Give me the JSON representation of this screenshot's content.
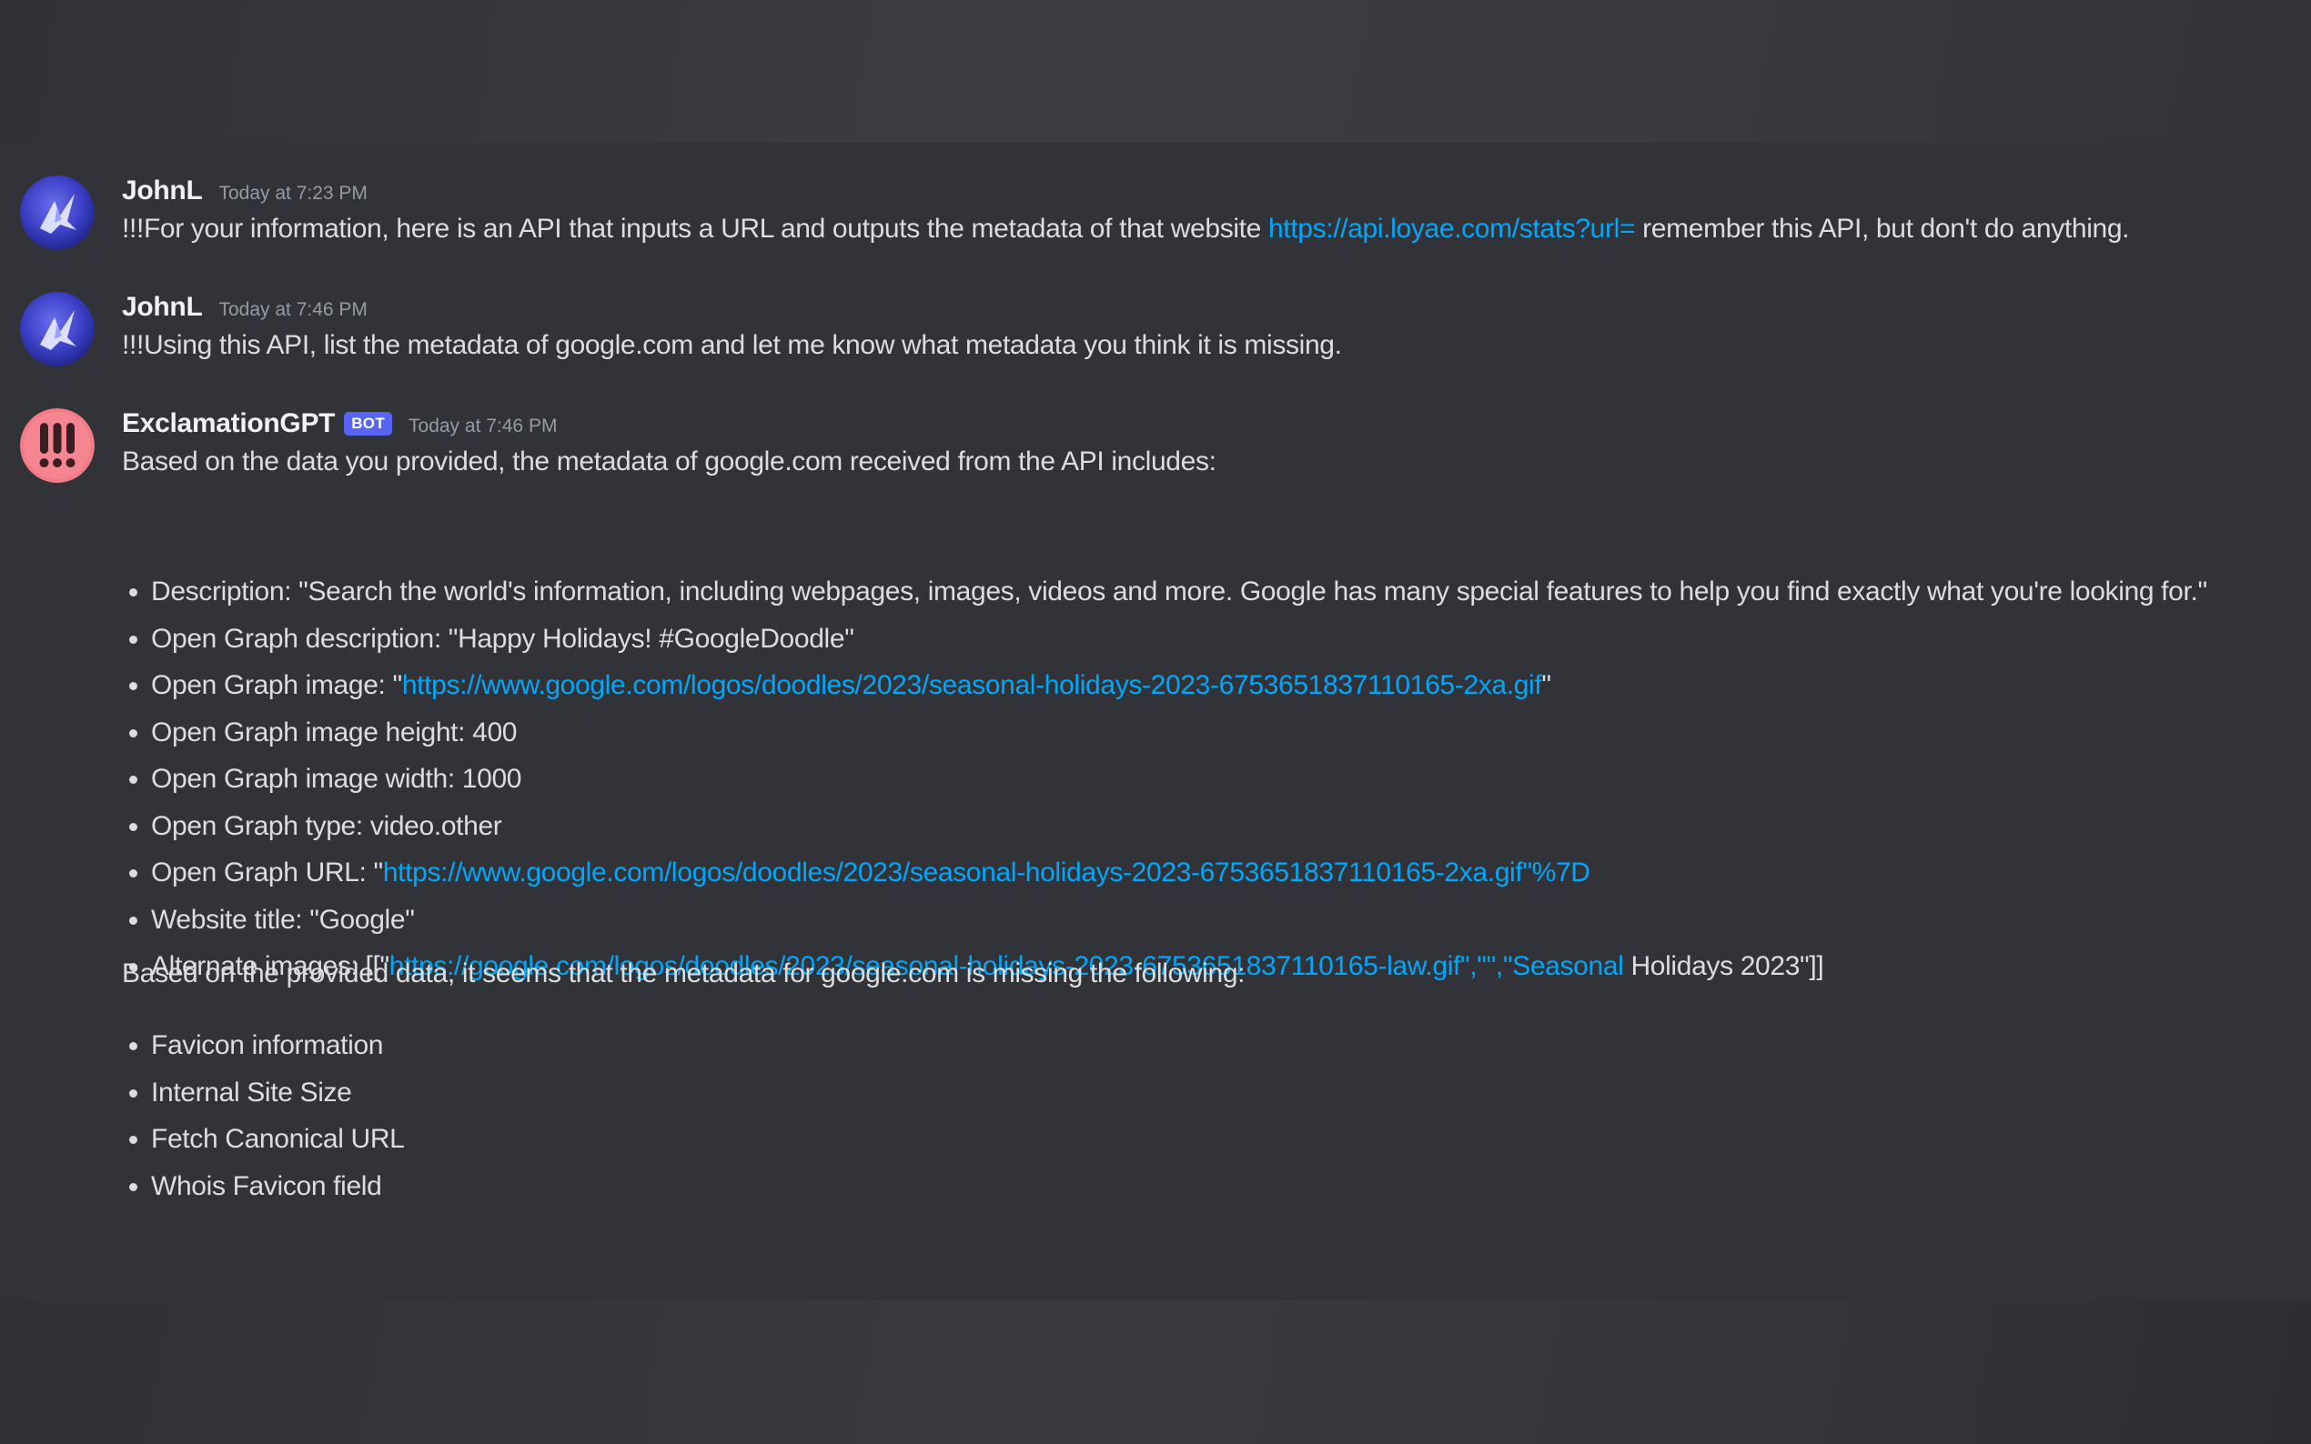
{
  "messages": [
    {
      "username": "JohnL",
      "timestamp": "Today at 7:23 PM",
      "text_before": "!!!For your information, here is an API that inputs a URL and outputs the metadata of that website ",
      "link": "https://api.loyae.com/stats?url=",
      "text_after": " remember this API, but don't do anything."
    },
    {
      "username": "JohnL",
      "timestamp": "Today at 7:46 PM",
      "text": "!!!Using this API, list the metadata of google.com and let me know what metadata you think it is missing."
    },
    {
      "username": "ExclamationGPT",
      "bot_tag": "BOT",
      "timestamp": "Today at 7:46 PM",
      "intro": "Based on the data you provided, the metadata of google.com received from the API includes:",
      "metadata_items": [
        {
          "text": "Description: \"Search the world's information, including webpages, images, videos and more. Google has many special features to help you find exactly what you're looking for.\""
        },
        {
          "text": "Open Graph description: \"Happy Holidays! #GoogleDoodle\""
        },
        {
          "prefix": "Open Graph image: \"",
          "link": "https://www.google.com/logos/doodles/2023/seasonal-holidays-2023-6753651837110165-2xa.gif",
          "suffix": "\""
        },
        {
          "text": "Open Graph image height: 400"
        },
        {
          "text": "Open Graph image width: 1000"
        },
        {
          "text": "Open Graph type: video.other"
        },
        {
          "prefix": "Open Graph URL: \"",
          "link": "https://www.google.com/logos/doodles/2023/seasonal-holidays-2023-6753651837110165-2xa.gif\"%7D",
          "suffix": ""
        },
        {
          "text": "Website title: \"Google\""
        },
        {
          "prefix": "Alternate images: [[\"",
          "link": "https://google.com/logos/doodles/2023/seasonal-holidays-2023-6753651837110165-law.gif\",\"\",\"Seasonal",
          "suffix": " Holidays 2023\"]]"
        }
      ],
      "missing_intro": "Based on the provided data, it seems that the metadata for google.com is missing the following:",
      "missing_items": [
        "Favicon information",
        "Internal Site Size",
        "Fetch Canonical URL",
        "Whois Favicon field"
      ]
    }
  ],
  "colors": {
    "background": "#313338",
    "text": "#dbdee1",
    "username": "#f2f3f5",
    "timestamp": "#949ba4",
    "link": "#00a8fc",
    "bot_tag": "#5865f2",
    "bot_avatar": "#f47b85"
  },
  "icons": {
    "user_avatar": "blue-abstract-avatar",
    "bot_avatar": "exclamation-marks-avatar"
  }
}
